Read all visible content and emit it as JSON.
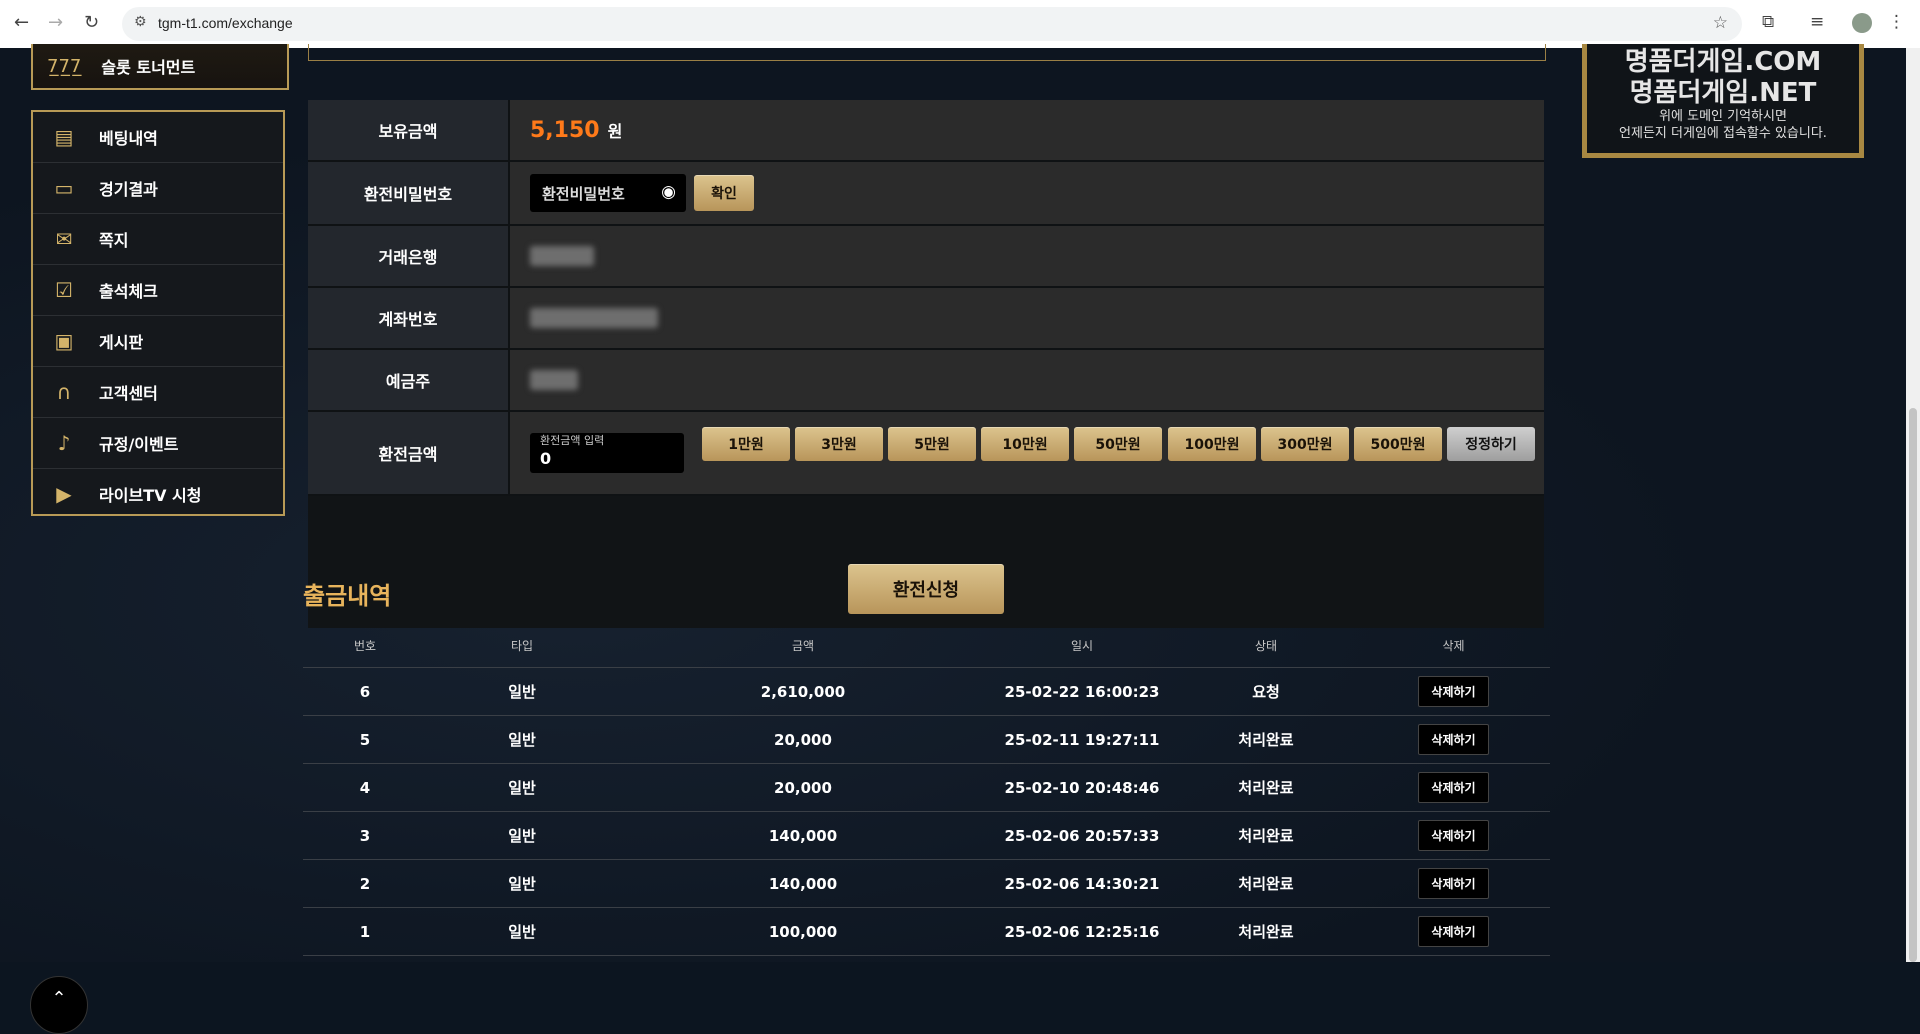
{
  "browser": {
    "url": "tgm-t1.com/exchange"
  },
  "sidebar": {
    "top_item": {
      "label": "슬롯 토너먼트",
      "icon": "slot-icon"
    },
    "items": [
      {
        "label": "베팅내역",
        "icon": "receipt-icon"
      },
      {
        "label": "경기결과",
        "icon": "scoreboard-icon"
      },
      {
        "label": "쪽지",
        "icon": "mail-icon"
      },
      {
        "label": "출석체크",
        "icon": "checkbox-icon"
      },
      {
        "label": "게시판",
        "icon": "clipboard-icon"
      },
      {
        "label": "고객센터",
        "icon": "headset-icon"
      },
      {
        "label": "규정/이벤트",
        "icon": "bell-icon"
      },
      {
        "label": "라이브TV 시청",
        "icon": "tv-icon"
      }
    ]
  },
  "form": {
    "balance_label": "보유금액",
    "balance_value": "5,150",
    "balance_unit": "원",
    "password_label": "환전비밀번호",
    "password_placeholder": "환전비밀번호",
    "confirm_label": "확인",
    "bank_label": "거래은행",
    "account_label": "계좌번호",
    "holder_label": "예금주",
    "amount_label": "환전금액",
    "amount_placeholder": "환전금액 입력",
    "amount_value": "0",
    "amount_buttons": [
      "1만원",
      "3만원",
      "5만원",
      "10만원",
      "50만원",
      "100만원",
      "300만원",
      "500만원"
    ],
    "reset_label": "정정하기",
    "submit_label": "환전신청"
  },
  "history": {
    "title": "출금내역",
    "columns": [
      "번호",
      "타입",
      "금액",
      "일시",
      "상태",
      "삭제"
    ],
    "delete_label": "삭제하기",
    "rows": [
      {
        "no": "6",
        "type": "일반",
        "amount": "2,610,000",
        "date": "25-02-22 16:00:23",
        "status": "요청"
      },
      {
        "no": "5",
        "type": "일반",
        "amount": "20,000",
        "date": "25-02-11 19:27:11",
        "status": "처리완료"
      },
      {
        "no": "4",
        "type": "일반",
        "amount": "20,000",
        "date": "25-02-10 20:48:46",
        "status": "처리완료"
      },
      {
        "no": "3",
        "type": "일반",
        "amount": "140,000",
        "date": "25-02-06 20:57:33",
        "status": "처리완료"
      },
      {
        "no": "2",
        "type": "일반",
        "amount": "140,000",
        "date": "25-02-06 14:30:21",
        "status": "처리완료"
      },
      {
        "no": "1",
        "type": "일반",
        "amount": "100,000",
        "date": "25-02-06 12:25:16",
        "status": "처리완료"
      }
    ]
  },
  "banner": {
    "domain1": "명품더게임.COM",
    "domain2": "명품더게임.NET",
    "line1": "위에 도메인 기억하시면",
    "line2": "언제든지 더게임에 접속할수 있습니다."
  },
  "colors": {
    "accent_gold": "#b89a56",
    "balance_orange": "#ff7a1a",
    "history_title": "#e8b45c"
  }
}
